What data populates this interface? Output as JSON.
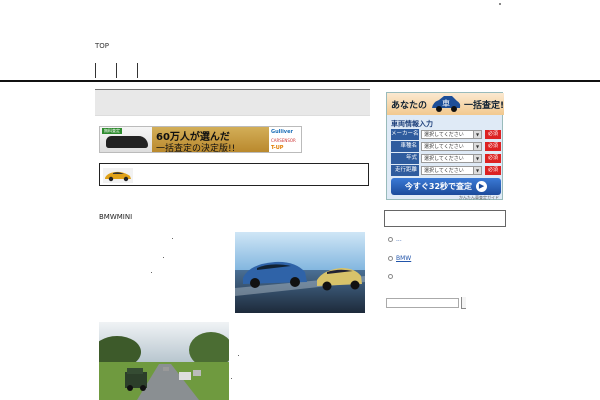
{
  "header": {
    "top_link": "TOP"
  },
  "ad_banner": {
    "tag": "無料査定",
    "headline": "60万人が選んだ",
    "subline": "一括査定の決定版!!",
    "logos": [
      "Gulliver",
      "CARSENSOR",
      "T-UP"
    ]
  },
  "main": {
    "article_title": "BMWMINI"
  },
  "sidebar_ad": {
    "head_left": "あなたの",
    "head_car_char": "車",
    "head_right": "一括査定!",
    "title": "車両情報入力",
    "rows": [
      {
        "label": "メーカー名",
        "value": "選択してください",
        "required": "必須"
      },
      {
        "label": "車種名",
        "value": "選択してください",
        "required": "必須"
      },
      {
        "label": "年式",
        "value": "選択してください",
        "required": "必須"
      },
      {
        "label": "走行距離",
        "value": "選択してください",
        "required": "必須"
      }
    ],
    "submit": "今すぐ32秒で査定",
    "caption": "かんたん車査定ガイド"
  },
  "sidebar": {
    "items": [
      "...",
      "BMW",
      ""
    ]
  },
  "colors": {
    "accent_blue": "#2f5c9e",
    "required_red": "#dd2222",
    "ad_gold": "#c89a3f"
  }
}
